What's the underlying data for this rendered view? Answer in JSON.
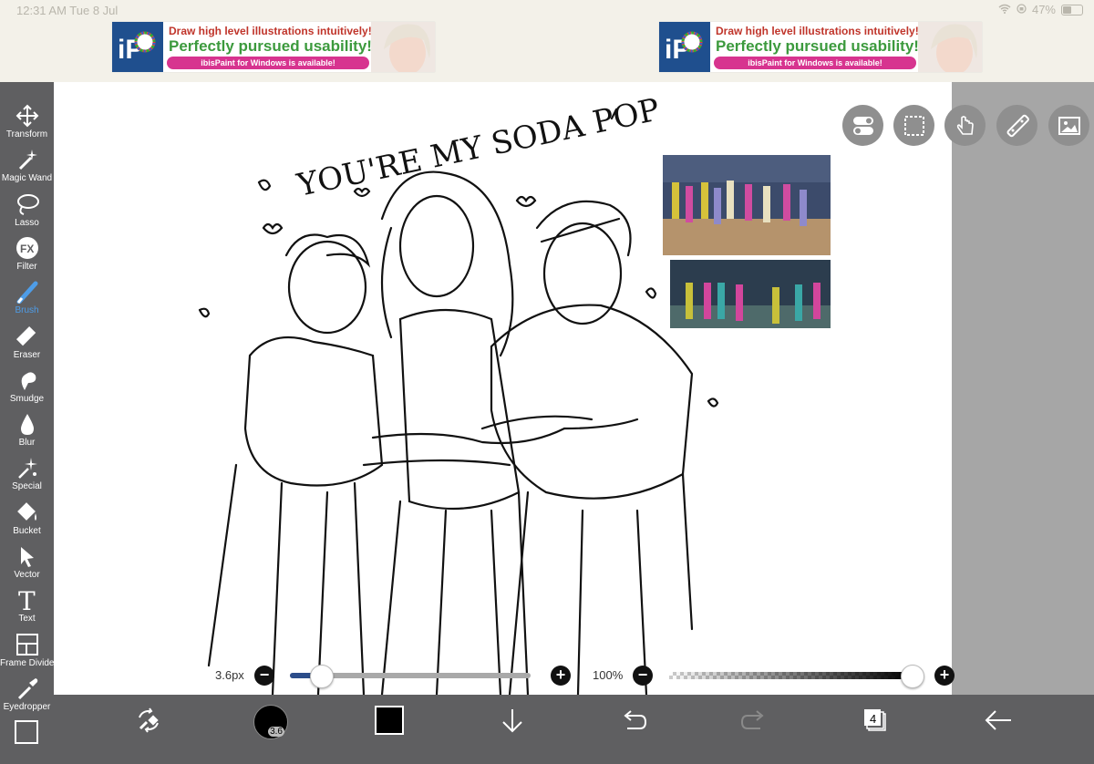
{
  "status": {
    "time": "12:31 AM  Tue 8 Jul",
    "battery": "47%",
    "battery_level": 0.47
  },
  "ads": [
    {
      "line1": "Draw high level illustrations intuitively!",
      "line2": "Perfectly pursued usability!",
      "line3": "ibisPaint for Windows is available!",
      "logo_text": "iP"
    },
    {
      "line1": "Draw high level illustrations intuitively!",
      "line2": "Perfectly pursued usability!",
      "line3": "ibisPaint for Windows is available!",
      "logo_text": "iP"
    }
  ],
  "tools": [
    {
      "label": "Transform",
      "icon": "move-icon"
    },
    {
      "label": "Magic Wand",
      "icon": "magic-wand-icon"
    },
    {
      "label": "Lasso",
      "icon": "lasso-icon"
    },
    {
      "label": "Filter",
      "icon": "fx-icon",
      "glyph": "FX"
    },
    {
      "label": "Brush",
      "icon": "brush-icon",
      "active": true
    },
    {
      "label": "Eraser",
      "icon": "eraser-icon"
    },
    {
      "label": "Smudge",
      "icon": "smudge-icon"
    },
    {
      "label": "Blur",
      "icon": "blur-drop-icon"
    },
    {
      "label": "Special",
      "icon": "sparkle-icon"
    },
    {
      "label": "Bucket",
      "icon": "bucket-icon"
    },
    {
      "label": "Vector",
      "icon": "vector-cursor-icon"
    },
    {
      "label": "Text",
      "icon": "text-icon",
      "glyph": "T"
    },
    {
      "label": "Frame Divider",
      "icon": "frame-divider-icon"
    },
    {
      "label": "Eyedropper",
      "icon": "eyedropper-icon"
    }
  ],
  "canvas": {
    "title_text": "YOU'RE MY SODA POP"
  },
  "sliders": {
    "brush_size_label": "3.6px",
    "brush_size_fraction": 0.13,
    "opacity_label": "100%",
    "opacity_fraction": 1.0
  },
  "bottom": {
    "brush_preview_value": "3.6",
    "layer_count": "4",
    "color": "#000000"
  }
}
